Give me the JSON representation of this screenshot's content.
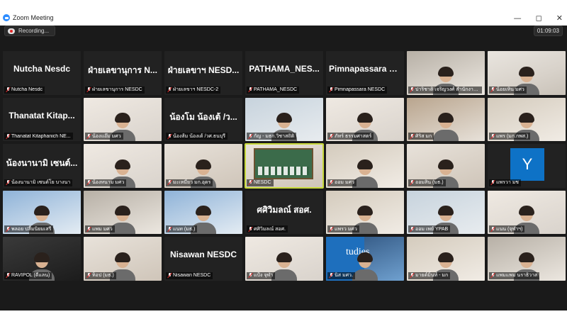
{
  "window": {
    "title": "Zoom Meeting",
    "controls": {
      "minimize": "—",
      "maximize": "◻",
      "close": "✕"
    }
  },
  "meeting": {
    "recording_label": "Recording...",
    "timer": "01:09:03"
  },
  "tiles": [
    {
      "name": "Nutcha Nesdc",
      "big": "Nutcha Nesdc",
      "bg": "plain"
    },
    {
      "name": "ฝ่ายเลขานุการ NESDC",
      "big": "ฝ่ายเลขานุการ N...",
      "bg": "plain"
    },
    {
      "name": "ฝ่ายเลขาฯ NESDC-2",
      "big": "ฝ่ายเลขาฯ NESD...",
      "bg": "plain"
    },
    {
      "name": "PATHAMA_NESDC",
      "big": "PATHAMA_NES...",
      "bg": "plain"
    },
    {
      "name": "Pimnapassara NESDC",
      "big": "Pimnapassara N...",
      "bg": "plain"
    },
    {
      "name": "ปาริชาติ เจริญวงศ์ สำนักงานสศ.",
      "big": "",
      "bg": "v6"
    },
    {
      "name": "น้อยเหิน มศว",
      "big": "",
      "bg": "v1"
    },
    {
      "name": "Thanatat Kitaphanich NE...",
      "big": "Thanatat Kitap...",
      "bg": "plain"
    },
    {
      "name": "น้องแอ๊ม มศว",
      "big": "",
      "bg": "v2"
    },
    {
      "name": "น้องส้ม น้องเต้ /วศ.ธนบุรี",
      "big": "น้องโม น้องเต้ /ว...",
      "bg": "plain"
    },
    {
      "name": "กัญ - มธก.วิชาสถิติ",
      "big": "",
      "bg": "v3"
    },
    {
      "name": "ภัทร์ ธรรมศาสตร์",
      "big": "",
      "bg": "v2"
    },
    {
      "name": "ศิริส มก",
      "big": "",
      "bg": "v4"
    },
    {
      "name": "แพร (มก.กพส.)",
      "big": "",
      "bg": "v10"
    },
    {
      "name": "น้องนานามิ เซนต์โย บางนา",
      "big": "น้องนานามิ เซนต์...",
      "bg": "plain"
    },
    {
      "name": "น้องหนาม มศว",
      "big": "",
      "bg": "v2"
    },
    {
      "name": "มะเหมี่ยว มก.อุดร",
      "big": "",
      "bg": "v8"
    },
    {
      "name": "NESDC",
      "big": "",
      "bg": "slide",
      "active": true
    },
    {
      "name": "ออม มศว",
      "big": "",
      "bg": "v10"
    },
    {
      "name": "ออมสิน (มธ.)",
      "big": "",
      "bg": "v8"
    },
    {
      "name": "แพรวา มช",
      "big": "",
      "bg": "avatar",
      "avatar": "Y"
    },
    {
      "name": "พลอย ปลื้มนิยมเสรี",
      "big": "",
      "bg": "v5"
    },
    {
      "name": "แพม มศว",
      "big": "",
      "bg": "v6"
    },
    {
      "name": "แนท (มธ.)",
      "big": "",
      "bg": "v5"
    },
    {
      "name": "ศศิวิมลณ์ สอศ.",
      "big": "ศศิวิมลณ์ สอศ.",
      "bg": "plain"
    },
    {
      "name": "แพรว มศว",
      "big": "",
      "bg": "v10"
    },
    {
      "name": "ออม เพย์ YPAB",
      "big": "",
      "bg": "v3"
    },
    {
      "name": "แนน (จุฬาฯ)",
      "big": "",
      "bg": "v2"
    },
    {
      "name": "RAVIPOL (ดีแลน)",
      "big": "",
      "bg": "v9"
    },
    {
      "name": "ท็อป (มธ.)",
      "big": "",
      "bg": "v8"
    },
    {
      "name": "Nisawan NESDC",
      "big": "Nisawan NESDC",
      "bg": "plain"
    },
    {
      "name": "แป้ง จุฬา",
      "big": "",
      "bg": "v2"
    },
    {
      "name": "นิส มศว.",
      "big": "",
      "bg": "studies",
      "logo": "tudies"
    },
    {
      "name": "มายด์มิ้นท์ - มก",
      "big": "",
      "bg": "v10"
    },
    {
      "name": "แพมแพม นราธิวาส",
      "big": "",
      "bg": "v6"
    }
  ]
}
